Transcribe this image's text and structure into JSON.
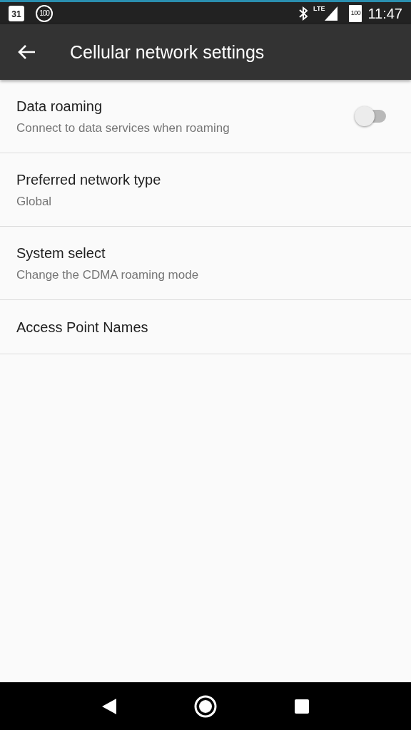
{
  "status_bar": {
    "calendar_day": "31",
    "notification_badge": "100",
    "network": "LTE",
    "battery": "100",
    "time": "11:47"
  },
  "app_bar": {
    "title": "Cellular network settings"
  },
  "settings": [
    {
      "kind": "switch",
      "title": "Data roaming",
      "summary": "Connect to data services when roaming",
      "on": false
    },
    {
      "kind": "plain",
      "title": "Preferred network type",
      "summary": "Global"
    },
    {
      "kind": "plain",
      "title": "System select",
      "summary": "Change the CDMA roaming mode"
    },
    {
      "kind": "plain",
      "title": "Access Point Names"
    }
  ]
}
